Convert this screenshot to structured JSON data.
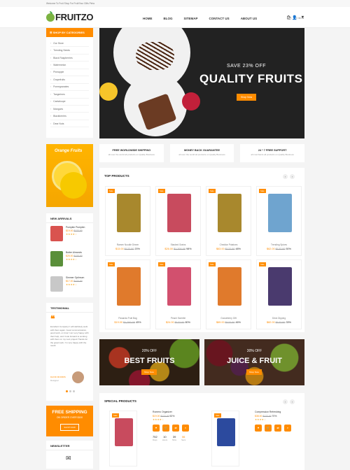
{
  "topbar": {
    "text": "Welcome To Fruit Shop For Fruit/Your Gifts Pinta"
  },
  "header": {
    "logo": "FRUITZO",
    "nav": [
      "HOME",
      "BLOG",
      "SITEMAP",
      "CONTACT US",
      "ABOUT US"
    ],
    "cart_label": "0 items"
  },
  "sidebar": {
    "categories_title": "SHOP BY CATEGORIES",
    "categories": [
      "Our Store",
      "Trending Seeds",
      "Black Raspberries",
      "Watermelon",
      "Pineapple",
      "Grapefruits",
      "Pomegranates",
      "Tangerines",
      "Cantaloupe",
      "Mangoes",
      "Blackberries",
      "Dear Nuts"
    ],
    "promo_title": "Orange Fruits",
    "new_arrivals_title": "NEW ARRIVALS",
    "new_arrivals": [
      {
        "name": "Pumpkin Pumpkin",
        "price": "$19.00",
        "old": "$122.00"
      },
      {
        "name": "Butter Almonds",
        "price": "$25.00",
        "old": "$133.00"
      },
      {
        "name": "Simmer Optimum",
        "price": "$17.00",
        "old": "$122.00"
      }
    ],
    "testimonial_title": "TESTIMONIAL",
    "testimonial_text": "Excellent Company! I will definitely work with them again. Good communication, good work, on time! I am very happy with their help, and I look forward to working with them on my next project.Thanks for the great work. I'm very happy with the result.",
    "testimonial_author": "DAVID MORRIS",
    "testimonial_role": "Designer",
    "free_shipping_title": "FREE SHIPPING",
    "free_shipping_sub": "ON ORDER OVER $100",
    "free_shipping_btn": "SHOP NOW",
    "newsletter_title": "NEWSLETTER"
  },
  "hero": {
    "save": "SAVE 23% OFF",
    "title": "QUALITY FRUITS",
    "button": "Shop Now"
  },
  "features": [
    {
      "title": "FREE WORLDWIDE SHIPPING",
      "sub": "all over the world all products on Quality Business"
    },
    {
      "title": "MONEY BACK GUARANTEE",
      "sub": "all over the world all products on Quality Business"
    },
    {
      "title": "24 * 7 FREE SUPPORT",
      "sub": "all merchants all products on Quality Business"
    }
  ],
  "top_products": {
    "title": "TOP PRODUCTS",
    "items": [
      {
        "badge": "Sale",
        "name": "Ramen Noodle Dinner",
        "price": "$13.00",
        "old": "$122.00",
        "pct": "20%",
        "color": "#a8882d"
      },
      {
        "badge": "Sale",
        "name": "Stacked Grains",
        "price": "$26.00",
        "old": "$1,200.00",
        "pct": "98%",
        "color": "#c84b5e"
      },
      {
        "badge": "Sale",
        "name": "Cheddar Potatoes",
        "price": "$63.00",
        "old": "$122.00",
        "pct": "48%",
        "color": "#a8882d"
      },
      {
        "badge": "Sale",
        "name": "Trending Spices",
        "price": "$62.00",
        "old": "$122.00",
        "pct": "50%",
        "color": "#6fa4cf"
      },
      {
        "badge": "Sale",
        "name": "Pasanda Fruit Bag",
        "price": "$19.00",
        "old": "$1,200.00",
        "pct": "45%",
        "color": "#e07a2c"
      },
      {
        "badge": "Sale",
        "name": "Peach Sweetie",
        "price": "$24.00",
        "old": "$122.00",
        "pct": "80%",
        "color": "#d2506e"
      },
      {
        "badge": "Sale",
        "name": "Gooseberry Gift",
        "price": "$69.00",
        "old": "$122.00",
        "pct": "46%",
        "color": "#e07a2c"
      },
      {
        "badge": "Sale",
        "name": "Deck Dipping",
        "price": "$82.00",
        "old": "$122.00",
        "pct": "33%",
        "color": "#4a3a6e"
      }
    ]
  },
  "banners": [
    {
      "save": "20% OFF",
      "title": "BEST FRUITS",
      "button": "Shop Now"
    },
    {
      "save": "30% OFF",
      "title": "JUICE & FRUIT",
      "button": "Shop Now"
    }
  ],
  "special_products": {
    "title": "SPECIAL PRODUCTS",
    "items": [
      {
        "name": "Romero Organizer",
        "price": "$19.00",
        "old": "$122.00",
        "pct": "52%",
        "color": "#c84b5e",
        "countdown": [
          {
            "v": "752",
            "l": "Days"
          },
          {
            "v": "10",
            "l": "Hours"
          },
          {
            "v": "39",
            "l": "Mins"
          },
          {
            "v": "06",
            "l": "Secs"
          }
        ]
      },
      {
        "name": "Compression Refreshing",
        "price": "$38.00",
        "old": "$122.00",
        "pct": "70%",
        "color": "#2c4a9e"
      }
    ]
  }
}
